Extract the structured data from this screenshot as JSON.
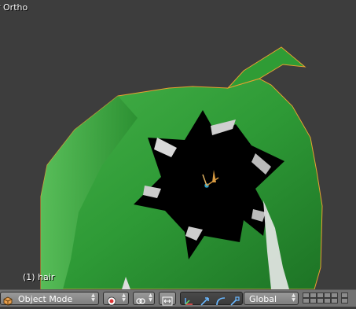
{
  "viewport": {
    "view_label": "r Ortho",
    "object_label": "(1) hair",
    "colors": {
      "background": "#3d3d3d",
      "hair_green": "#2e9a36",
      "hair_dark_green": "#1f7a27",
      "selection_outline": "#e8a030",
      "cavity": "#000000"
    }
  },
  "header": {
    "editor_type_icon": "cube-icon",
    "mode_label": "Object Mode",
    "shading_icon": "sphere-shading-icon",
    "pivot_icon": "pivot-point-icon",
    "snap_icon": "snap-icon",
    "manipulator_icon": "manipulator-icon",
    "transform_orientation_label": "Global",
    "layers_icon": "layers-grid-icon"
  }
}
